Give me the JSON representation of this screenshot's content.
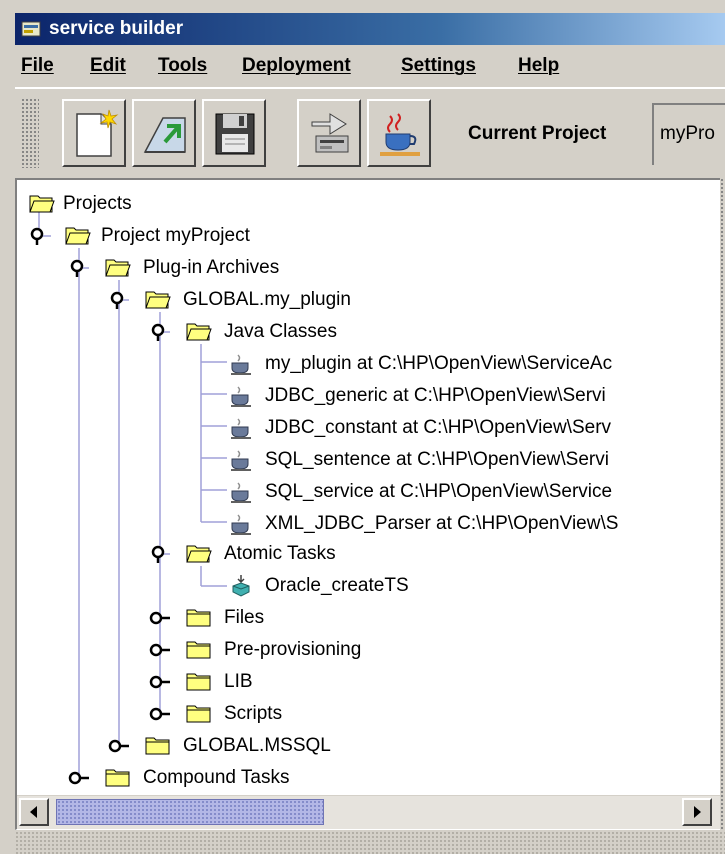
{
  "window": {
    "title": "service builder"
  },
  "menu": [
    {
      "label": "File"
    },
    {
      "label": "Edit"
    },
    {
      "label": "Tools"
    },
    {
      "label": "Deployment"
    },
    {
      "label": "Settings"
    },
    {
      "label": "Help"
    }
  ],
  "toolbar": {
    "buttons": [
      {
        "icon": "new-document-icon"
      },
      {
        "icon": "open-icon"
      },
      {
        "icon": "save-icon"
      },
      {
        "icon": "deploy-icon"
      },
      {
        "icon": "java-icon"
      }
    ],
    "current_project_label": "Current Project",
    "current_project_value": "myPro"
  },
  "tree": {
    "root": "Projects",
    "project": "Project myProject",
    "plugin_archives": "Plug-in Archives",
    "global_my_plugin": "GLOBAL.my_plugin",
    "java_classes": "Java Classes",
    "java_items": [
      "my_plugin at C:\\HP\\OpenView\\ServiceAc",
      "JDBC_generic at C:\\HP\\OpenView\\Servi",
      "JDBC_constant at C:\\HP\\OpenView\\Serv",
      "SQL_sentence at C:\\HP\\OpenView\\Servi",
      "SQL_service at C:\\HP\\OpenView\\Service",
      "XML_JDBC_Parser at C:\\HP\\OpenView\\S"
    ],
    "atomic_tasks": "Atomic Tasks",
    "atomic_item": "Oracle_createTS",
    "files": "Files",
    "pre_provisioning": "Pre-provisioning",
    "lib": "LIB",
    "scripts": "Scripts",
    "global_mssql": "GLOBAL.MSSQL",
    "compound_tasks": "Compound Tasks"
  },
  "colors": {
    "title_start": "#0b246a",
    "title_end": "#a6caf0",
    "folder": "#ffff80",
    "scroll_thumb": "#b3b7e6"
  }
}
